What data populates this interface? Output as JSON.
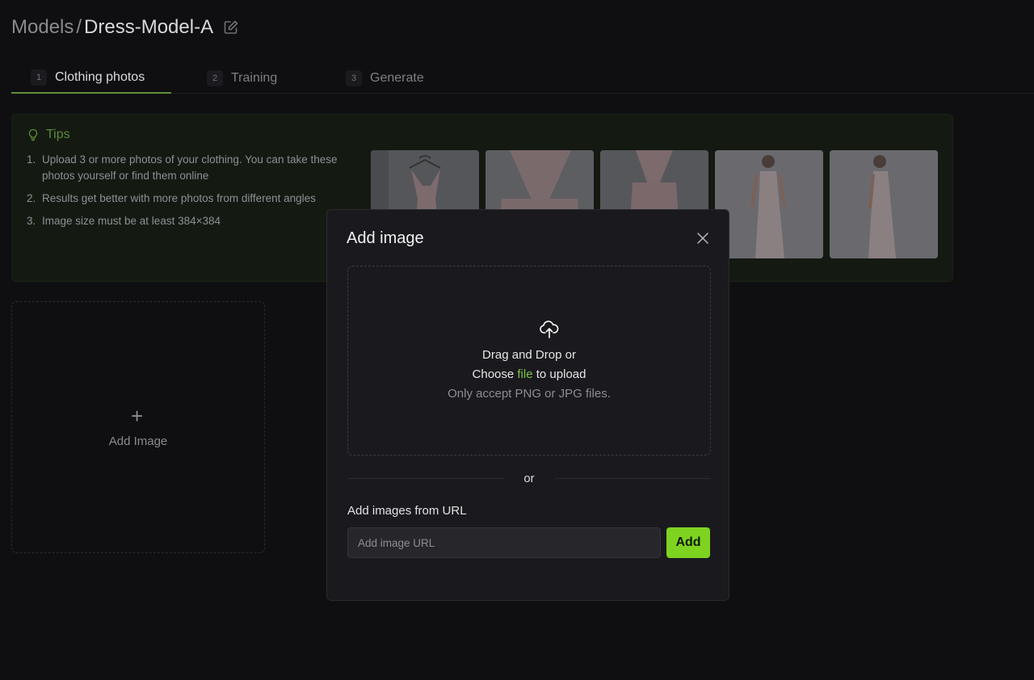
{
  "breadcrumb": {
    "root": "Models",
    "separator": "/",
    "current": "Dress-Model-A",
    "edit_icon": "pencil-square-icon"
  },
  "tabs": [
    {
      "num": "1",
      "label": "Clothing photos",
      "active": true
    },
    {
      "num": "2",
      "label": "Training",
      "active": false
    },
    {
      "num": "3",
      "label": "Generate",
      "active": false
    }
  ],
  "tips": {
    "title": "Tips",
    "icon": "lightbulb-icon",
    "items": [
      {
        "n": "1.",
        "text": "Upload 3 or more photos of your clothing. You can take these photos yourself or find them online"
      },
      {
        "n": "2.",
        "text": "Results get better with more photos from different angles"
      },
      {
        "n": "3.",
        "text": "Image size must be at least 384×384"
      }
    ]
  },
  "add_image_card": {
    "icon": "plus-icon",
    "label": "Add Image"
  },
  "modal": {
    "title": "Add image",
    "close_icon": "close-icon",
    "dropzone": {
      "icon": "cloud-upload-icon",
      "line1": "Drag and Drop or",
      "choose": "Choose",
      "file_link": "file",
      "to_upload": "to upload",
      "hint": "Only accept PNG or JPG files."
    },
    "divider_text": "or",
    "url_section": {
      "label": "Add images from URL",
      "placeholder": "Add image URL",
      "value": "",
      "button": "Add"
    }
  },
  "colors": {
    "accent": "#7ed321",
    "link": "#79c14a",
    "tips_title": "#5c8a3a",
    "overlay_bg": "#0f0f11"
  }
}
